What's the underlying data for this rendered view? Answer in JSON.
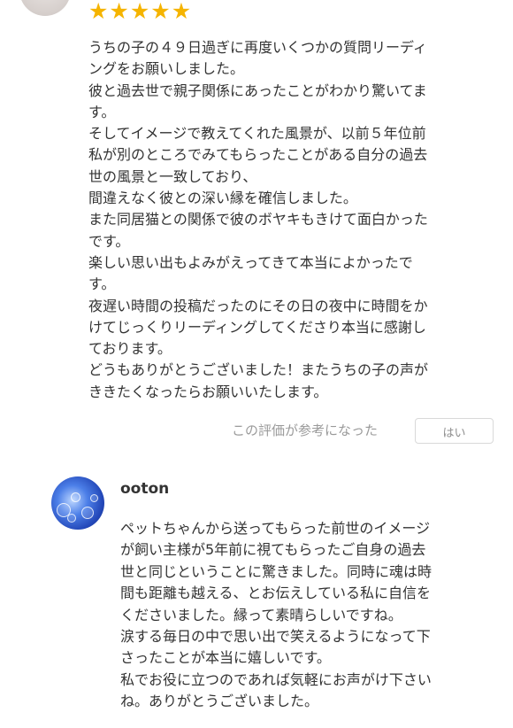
{
  "review": {
    "rating_icons": [
      "star-icon",
      "star-icon",
      "star-icon",
      "star-icon",
      "star-icon"
    ],
    "body_lines": [
      "うちの子の４９日過ぎに再度いくつかの質問リーディ",
      "ングをお願いしました。",
      "彼と過去世で親子関係にあったことがわかり驚いてま",
      "す。",
      "そしてイメージで教えてくれた風景が、以前５年位前",
      "私が別のところでみてもらったことがある自分の過去",
      "世の風景と一致しており、",
      "間違えなく彼との深い縁を確信しました。",
      "また同居猫との関係で彼のボヤキもきけて面白かった",
      "です。",
      "楽しい思い出もよみがえってきて本当によかったで",
      "す。",
      "夜遅い時間の投稿だったのにその日の夜中に時間をか",
      "けてじっくりリーディングしてくださり本当に感謝し",
      "ております。",
      "どうもありがとうございました！またうちの子の声が",
      "ききたくなったらお願いいたします。"
    ],
    "helpful_prompt": "この評価が参考になった",
    "helpful_button": "はい"
  },
  "reply": {
    "name": "ooton",
    "body_lines": [
      "ペットちゃんから送ってもらった前世のイメージ",
      "が飼い主様が5年前に視てもらったご自身の過去",
      "世と同じということに驚きました。同時に魂は時",
      "間も距離も越える、とお伝えしている私に自信を",
      "くださいました。縁って素晴らしいですね。",
      "涙する毎日の中で思い出で笑えるようになって下",
      "さったことが本当に嬉しいです。",
      "私でお役に立つのであれば気軽にお声がけ下さい",
      "ね。ありがとうございました。"
    ]
  },
  "colors": {
    "star": "#f5b400",
    "text": "#333333",
    "muted": "#9a9a9a"
  }
}
